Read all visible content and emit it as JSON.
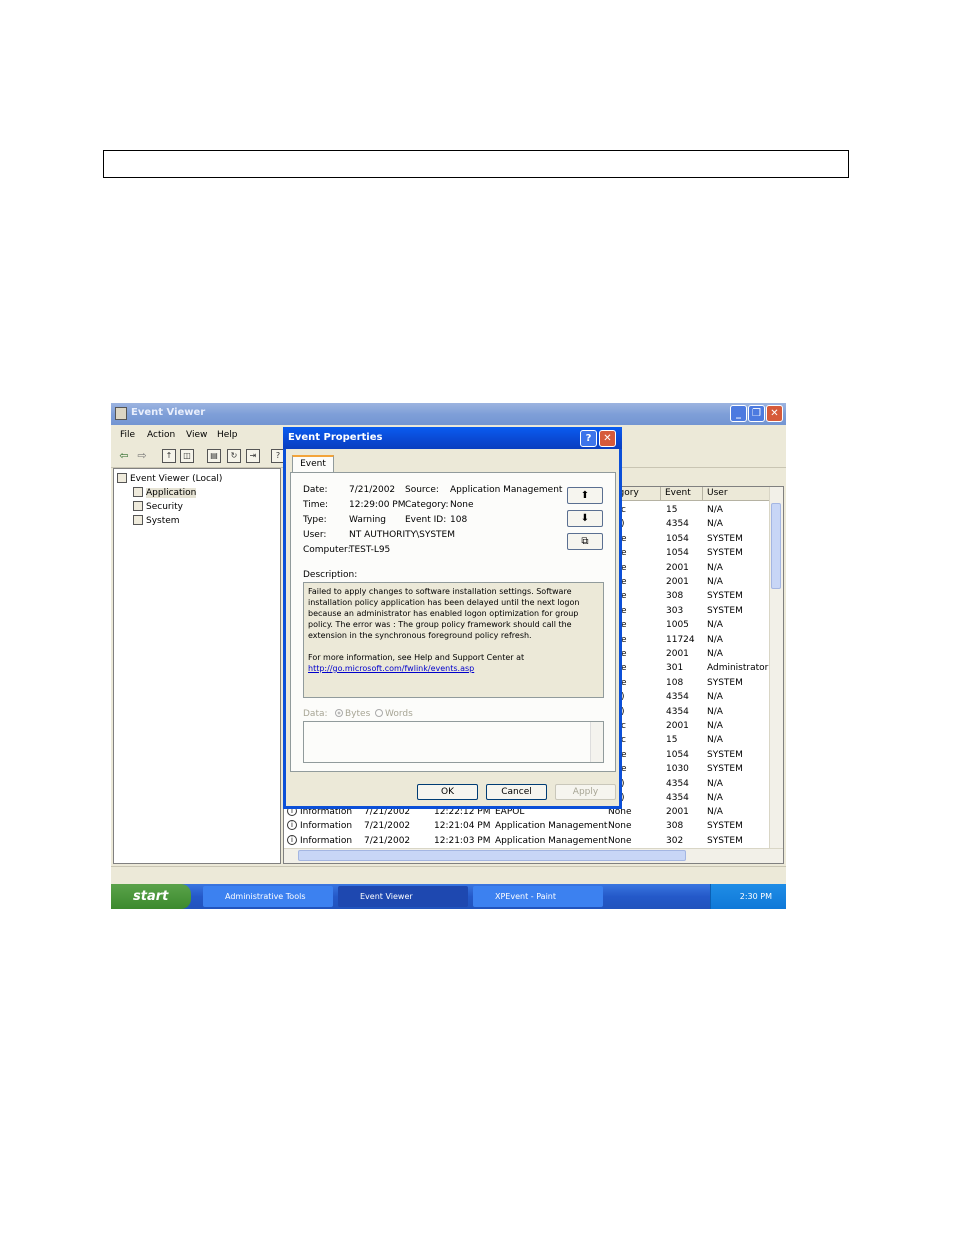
{
  "window": {
    "title": "Event Viewer"
  },
  "menu": [
    "File",
    "Action",
    "View",
    "Help"
  ],
  "tree": {
    "root": "Event Viewer (Local)",
    "items": [
      "Application",
      "Security",
      "System"
    ]
  },
  "list": {
    "columns": [
      "egory",
      "Event",
      "User"
    ],
    "side_rows": [
      {
        "c": "c",
        "event": "15",
        "user": "N/A"
      },
      {
        "c": ")",
        "event": "4354",
        "user": "N/A"
      },
      {
        "c": "e",
        "event": "1054",
        "user": "SYSTEM"
      },
      {
        "c": "e",
        "event": "1054",
        "user": "SYSTEM"
      },
      {
        "c": "e",
        "event": "2001",
        "user": "N/A"
      },
      {
        "c": "e",
        "event": "2001",
        "user": "N/A"
      },
      {
        "c": "e",
        "event": "308",
        "user": "SYSTEM"
      },
      {
        "c": "e",
        "event": "303",
        "user": "SYSTEM"
      },
      {
        "c": "e",
        "event": "1005",
        "user": "N/A"
      },
      {
        "c": "e",
        "event": "11724",
        "user": "N/A"
      },
      {
        "c": "e",
        "event": "2001",
        "user": "N/A"
      },
      {
        "c": "e",
        "event": "301",
        "user": "Administrator"
      },
      {
        "c": "e",
        "event": "108",
        "user": "SYSTEM"
      },
      {
        "c": ")",
        "event": "4354",
        "user": "N/A"
      },
      {
        "c": ")",
        "event": "4354",
        "user": "N/A"
      },
      {
        "c": "c",
        "event": "2001",
        "user": "N/A"
      },
      {
        "c": "c",
        "event": "15",
        "user": "N/A"
      },
      {
        "c": "e",
        "event": "1054",
        "user": "SYSTEM"
      },
      {
        "c": "e",
        "event": "1030",
        "user": "SYSTEM"
      },
      {
        "c": ")",
        "event": "4354",
        "user": "N/A"
      },
      {
        "c": ")",
        "event": "4354",
        "user": "N/A"
      }
    ],
    "bottom_rows": [
      {
        "type": "Information",
        "date": "7/21/2002",
        "time": "12:22:12 PM",
        "source": "EAPOL",
        "category": "None",
        "event": "2001",
        "user": "N/A"
      },
      {
        "type": "Information",
        "date": "7/21/2002",
        "time": "12:21:04 PM",
        "source": "Application Management",
        "category": "None",
        "event": "308",
        "user": "SYSTEM"
      },
      {
        "type": "Information",
        "date": "7/21/2002",
        "time": "12:21:03 PM",
        "source": "Application Management",
        "category": "None",
        "event": "302",
        "user": "SYSTEM"
      }
    ]
  },
  "dialog": {
    "title": "Event Properties",
    "tab": "Event",
    "date_label": "Date:",
    "date": "7/21/2002",
    "source_label": "Source:",
    "source": "Application Management",
    "time_label": "Time:",
    "time": "12:29:00 PM",
    "category_label": "Category:",
    "category": "None",
    "type_label": "Type:",
    "type": "Warning",
    "eventid_label": "Event ID:",
    "eventid": "108",
    "user_label": "User:",
    "user": "NT AUTHORITY\\SYSTEM",
    "computer_label": "Computer:",
    "computer": "TEST-L95",
    "description_label": "Description:",
    "description_p1": "Failed to apply changes to software installation settings.  Software installation policy application has been delayed until the next logon because an administrator has enabled logon optimization for group policy. The error was : The group policy framework should call the extension in the synchronous foreground policy refresh.",
    "description_p2": "For more information, see Help and Support Center at",
    "description_link": "http://go.microsoft.com/fwlink/events.asp",
    "data_label": "Data:",
    "bytes_label": "Bytes",
    "words_label": "Words",
    "ok": "OK",
    "cancel": "Cancel",
    "apply": "Apply"
  },
  "taskbar": {
    "start": "start",
    "tasks": [
      "Administrative Tools",
      "Event Viewer",
      "XPEvent - Paint"
    ],
    "clock": "2:30 PM"
  }
}
